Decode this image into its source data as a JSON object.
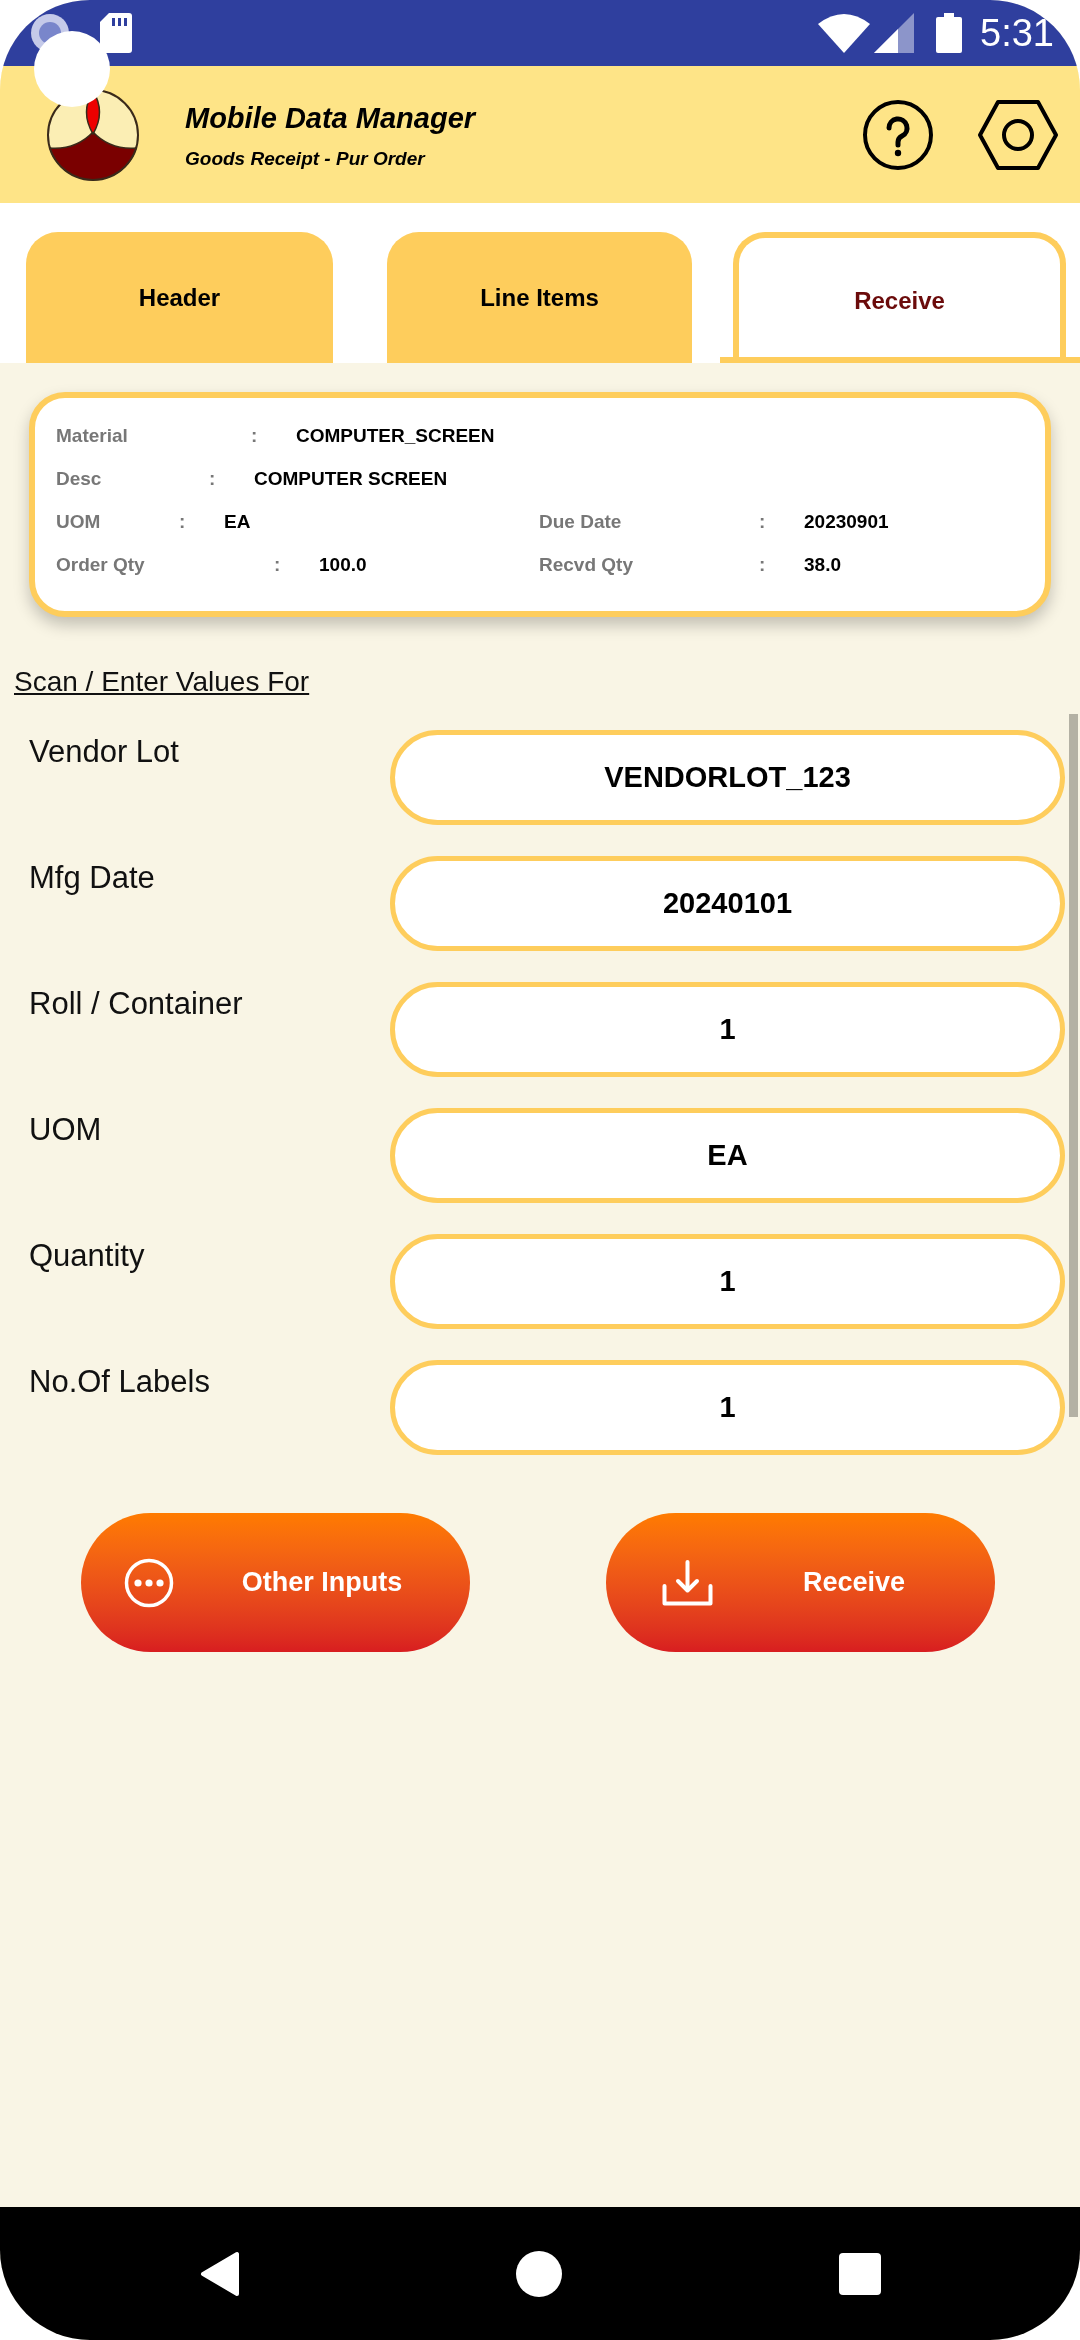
{
  "status_bar": {
    "time": "5:31"
  },
  "app_bar": {
    "title": "Mobile Data Manager",
    "subtitle": "Goods Receipt - Pur Order"
  },
  "tabs": [
    {
      "label": "Header",
      "selected": false
    },
    {
      "label": "Line Items",
      "selected": false
    },
    {
      "label": "Receive",
      "selected": true
    }
  ],
  "summary": {
    "rows": [
      [
        {
          "label": "Material",
          "separator": ":",
          "value": "COMPUTER_SCREEN"
        }
      ],
      [
        {
          "label": "Desc",
          "separator": ":",
          "value": "COMPUTER SCREEN"
        }
      ],
      [
        {
          "label": "UOM",
          "separator": ":",
          "value": "EA"
        },
        {
          "label": "Due Date",
          "separator": ":",
          "value": "20230901"
        }
      ],
      [
        {
          "label": "Order Qty",
          "separator": ":",
          "value": "100.0"
        },
        {
          "label": "Recvd Qty",
          "separator": ":",
          "value": "38.0"
        }
      ]
    ]
  },
  "section_title": "Scan / Enter Values For",
  "fields": [
    {
      "label": "Vendor Lot",
      "value": "VENDORLOT_123"
    },
    {
      "label": "Mfg Date",
      "value": "20240101"
    },
    {
      "label": "Roll / Container",
      "value": "1"
    },
    {
      "label": "UOM",
      "value": "EA"
    },
    {
      "label": "Quantity",
      "value": "1"
    },
    {
      "label": "No.Of Labels",
      "value": "1"
    }
  ],
  "buttons": [
    {
      "label": "Other Inputs",
      "kind": "options"
    },
    {
      "label": "Receive",
      "kind": "submit"
    }
  ]
}
